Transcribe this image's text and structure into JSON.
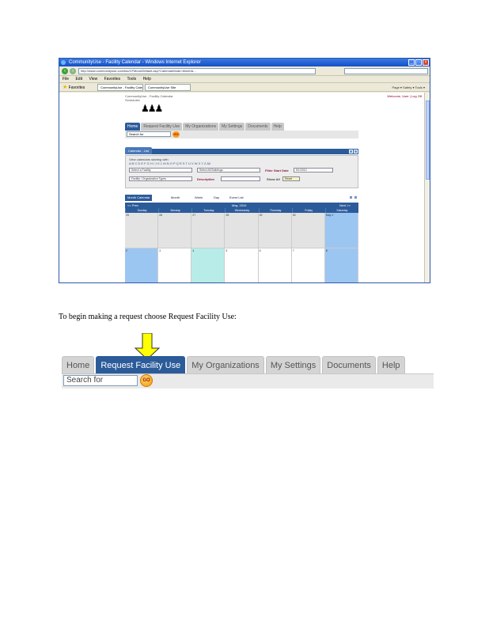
{
  "screenshot": {
    "window_title": "CommunityUse - Facility Calendar - Windows Internet Explorer",
    "address": "http://www.communityuse.com/fac/CFM/cal/Default.asp?CalendarMode=Month&...",
    "menu": [
      "File",
      "Edit",
      "View",
      "Favorites",
      "Tools",
      "Help"
    ],
    "favorites": "Favorites",
    "tabs": [
      "CommunityUse - Facility Calendar",
      "CommunityUse Site"
    ],
    "tools": "Page ▾ Safety ▾ Tools ▾",
    "site_title": "CommunityUse - Facility Calendar",
    "site_subtitle": "Schedules",
    "welcome": "Welcome, User | Log Off",
    "nav": [
      "Home",
      "Request Facility Use",
      "My Organizations",
      "My Settings",
      "Documents",
      "Help"
    ],
    "search_placeholder": "Search for",
    "go": "GO",
    "calendar_tab": "Calendar - List",
    "view_line": "View calendars starting with:",
    "letters": "A B C D E F G H I J K L M N O P Q R S T U V W X Y Z All",
    "filter_label": "Filter Start Date",
    "date_value": "5/1/2010",
    "description_label": "Description",
    "show_all": "Show All",
    "reset": "Reset",
    "org_select": "Facility / Organization Types",
    "select_facility": "Select a Facility",
    "select_building": "Select All Buildings",
    "views": {
      "month": "Month Calendar",
      "m": "Month",
      "w": "Week",
      "d": "Day",
      "list": "Event List"
    },
    "prev": "<< Prev",
    "month_label": "May, 2010",
    "next": "Next >>",
    "weekdays": [
      "Sunday",
      "Monday",
      "Tuesday",
      "Wednesday",
      "Thursday",
      "Friday",
      "Saturday"
    ],
    "week1": [
      "25",
      "26",
      "27",
      "28",
      "29",
      "30",
      "May 1"
    ],
    "week2": [
      "2",
      "3",
      "4",
      "5",
      "6",
      "7",
      "8"
    ]
  },
  "caption": "To begin  making a request  choose Request  Facility Use:",
  "zoom": {
    "nav": [
      "Home",
      "Request Facility Use",
      "My Organizations",
      "My Settings",
      "Documents",
      "Help"
    ],
    "search_placeholder": "Search for",
    "go": "GO"
  },
  "colors": {
    "nav_active": "#2c5b9a",
    "arrow": "#ffff00"
  }
}
